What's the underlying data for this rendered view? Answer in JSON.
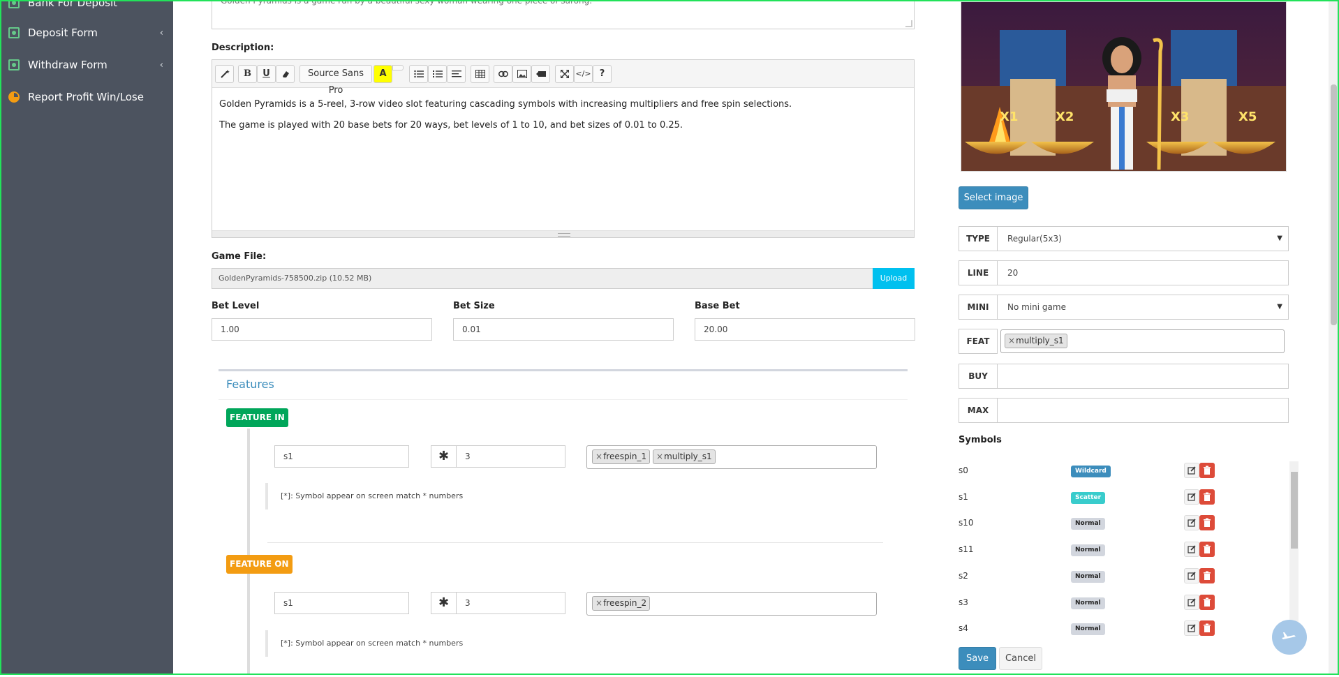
{
  "sidebar": {
    "items": [
      {
        "label": "Bank For Deposit",
        "icon": "money-icon"
      },
      {
        "label": "Deposit Form",
        "icon": "money-icon",
        "chevron": "‹"
      },
      {
        "label": "Withdraw Form",
        "icon": "money-icon",
        "chevron": "‹"
      },
      {
        "label": "Report Profit Win/Lose",
        "icon": "pie-chart-icon"
      }
    ]
  },
  "short_description": {
    "value": "Golden Pyramids is a game run by a beautiful sexy woman wearing one piece of sarong."
  },
  "description": {
    "label": "Description:",
    "toolbar": {
      "font_name": "Source Sans Pro",
      "buttons": [
        "magic",
        "B",
        "U",
        "eraser",
        "A",
        "ul",
        "ol",
        "align",
        "table",
        "link",
        "picture",
        "video",
        "fullscreen",
        "</>",
        "?"
      ]
    },
    "paragraphs": [
      "Golden Pyramids is a 5-reel, 3-row video slot featuring cascading symbols with increasing multipliers and free spin selections.",
      "The game is played with 20 base bets for 20 ways, bet levels of 1 to 10, and bet sizes of 0.01 to 0.25."
    ]
  },
  "game_file": {
    "label": "Game File:",
    "value": "GoldenPyramids-758500.zip (10.52 MB)",
    "upload_label": "Upload"
  },
  "bet": {
    "level_label": "Bet Level",
    "level_value": "1.00",
    "size_label": "Bet Size",
    "size_value": "0.01",
    "base_label": "Base Bet",
    "base_value": "20.00"
  },
  "features": {
    "title": "Features",
    "feature_in": {
      "badge": "FEATURE IN",
      "symbol": "s1",
      "star": "✱",
      "count": "3",
      "tags": [
        "freespin_1",
        "multiply_s1"
      ],
      "note": "[*]: Symbol appear on screen match * numbers"
    },
    "feature_on": {
      "badge": "FEATURE ON",
      "symbol": "s1",
      "star": "✱",
      "count": "3",
      "tags": [
        "freespin_2"
      ],
      "note": "[*]: Symbol appear on screen match * numbers"
    }
  },
  "right": {
    "preview": {
      "multipliers": [
        "X1",
        "X2",
        "X3",
        "X5"
      ]
    },
    "select_image_label": "Select image",
    "fields": {
      "type_label": "TYPE",
      "type_value": "Regular(5x3)",
      "line_label": "LINE",
      "line_value": "20",
      "mini_label": "MINI",
      "mini_value": "No mini game",
      "feat_label": "FEAT",
      "feat_tag": "multiply_s1",
      "buy_label": "BUY",
      "buy_value": "",
      "max_label": "MAX",
      "max_value": ""
    },
    "symbols_title": "Symbols",
    "symbols": [
      {
        "name": "s0",
        "type": "Wildcard",
        "color": "#3c8dbc"
      },
      {
        "name": "s1",
        "type": "Scatter",
        "color": "#39cccc"
      },
      {
        "name": "s10",
        "type": "Normal",
        "color": "#d2d6de"
      },
      {
        "name": "s11",
        "type": "Normal",
        "color": "#d2d6de"
      },
      {
        "name": "s2",
        "type": "Normal",
        "color": "#d2d6de"
      },
      {
        "name": "s3",
        "type": "Normal",
        "color": "#d2d6de"
      },
      {
        "name": "s4",
        "type": "Normal",
        "color": "#d2d6de"
      }
    ],
    "save_label": "Save",
    "cancel_label": "Cancel"
  },
  "colors": {
    "feature_in": "#00a65a",
    "feature_on": "#f39c12",
    "primary": "#3c8dbc",
    "danger": "#dd4b39",
    "upload": "#00c0ef"
  }
}
